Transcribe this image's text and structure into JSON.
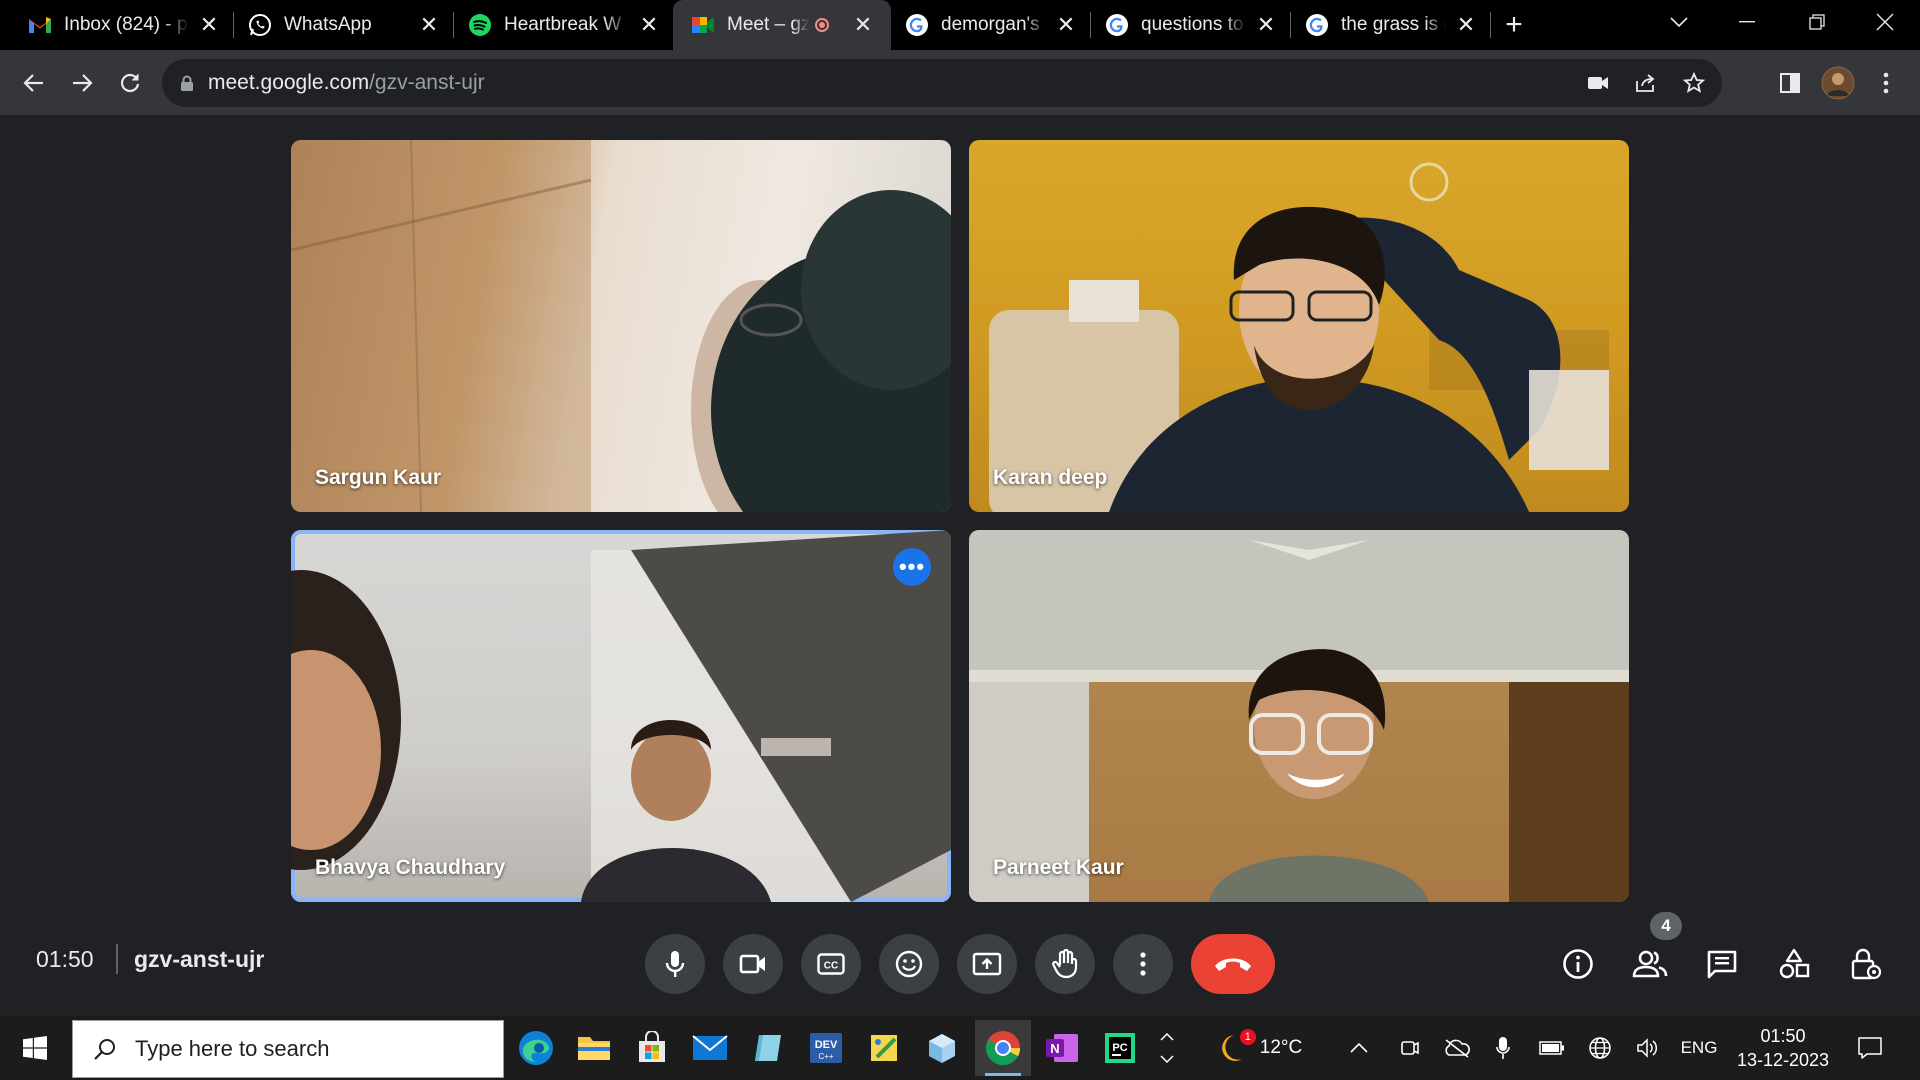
{
  "browser": {
    "tabs": [
      {
        "title": "Inbox (824) - p",
        "icon": "gmail-icon"
      },
      {
        "title": "WhatsApp",
        "icon": "whatsapp-icon"
      },
      {
        "title": "Heartbreak W",
        "icon": "spotify-icon"
      },
      {
        "title": "Meet – gz",
        "icon": "meet-icon",
        "active": true,
        "recording": true
      },
      {
        "title": "demorgan's la",
        "icon": "google-icon"
      },
      {
        "title": "questions to a",
        "icon": "google-icon"
      },
      {
        "title": "the grass is gr",
        "icon": "google-icon"
      }
    ],
    "url_host": "meet.google.com",
    "url_path": "/gzv-anst-ujr"
  },
  "meet": {
    "participants": [
      {
        "name": "Sargun Kaur"
      },
      {
        "name": "Karan deep"
      },
      {
        "name": "Bhavya Chaudhary",
        "speaking": true
      },
      {
        "name": "Parneet Kaur"
      }
    ],
    "time": "01:50",
    "meeting_code": "gzv-anst-ujr",
    "people_count": "4",
    "colors": {
      "end_call": "#ea4335",
      "highlight": "#8ab4f8",
      "more_button": "#1a73e8"
    }
  },
  "taskbar": {
    "search_placeholder": "Type here to search",
    "weather_temp": "12°C",
    "weather_badge": "1",
    "language": "ENG",
    "time": "01:50",
    "date": "13-12-2023"
  }
}
